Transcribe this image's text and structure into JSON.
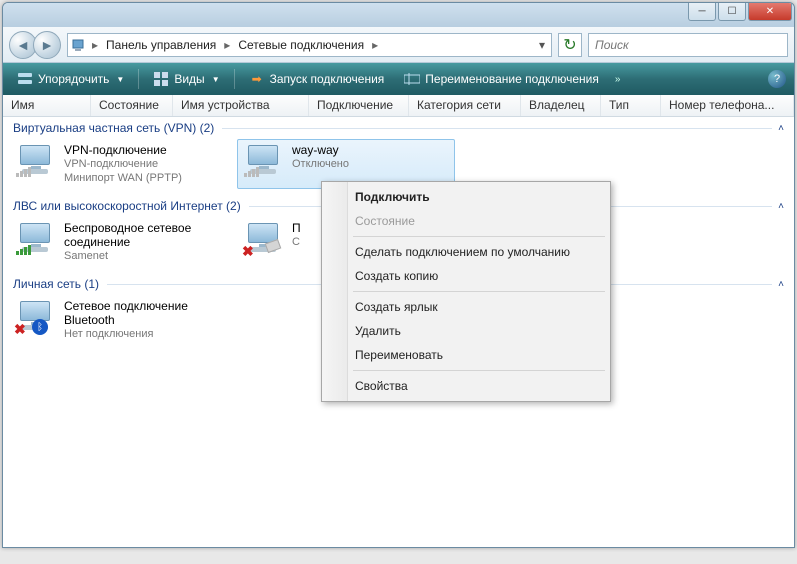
{
  "breadcrumb": {
    "seg1": "Панель управления",
    "seg2": "Сетевые подключения"
  },
  "search": {
    "placeholder": "Поиск"
  },
  "toolbar": {
    "organize": "Упорядочить",
    "views": "Виды",
    "start_conn": "Запуск подключения",
    "rename_conn": "Переименование подключения"
  },
  "columns": [
    "Имя",
    "Состояние",
    "Имя устройства",
    "Подключение",
    "Категория сети",
    "Владелец",
    "Тип",
    "Номер телефона..."
  ],
  "groups": [
    {
      "title": "Виртуальная частная сеть (VPN) (2)",
      "items": [
        {
          "l1": "VPN-подключение",
          "l2": "VPN-подключение",
          "l3": "Минипорт WAN (PPTP)",
          "kind": "vpn"
        },
        {
          "l1": "way-way",
          "l2": "Отключено",
          "l3": "",
          "kind": "vpn",
          "selected": true
        }
      ]
    },
    {
      "title": "ЛВС или высокоскоростной Интернет (2)",
      "items": [
        {
          "l1": "Беспроводное сетевое",
          "l2": "соединение",
          "l3": "Samenet",
          "kind": "wifi"
        },
        {
          "l1": "П",
          "l2": "С",
          "l3": "",
          "kind": "lan-x"
        }
      ]
    },
    {
      "title": "Личная сеть (1)",
      "items": [
        {
          "l1": "Сетевое подключение",
          "l2": "Bluetooth",
          "l3": "Нет подключения",
          "kind": "bt"
        }
      ]
    }
  ],
  "ctx": {
    "connect": "Подключить",
    "status": "Состояние",
    "make_default": "Сделать подключением по умолчанию",
    "copy": "Создать копию",
    "shortcut": "Создать ярлык",
    "delete": "Удалить",
    "rename": "Переименовать",
    "props": "Свойства"
  }
}
